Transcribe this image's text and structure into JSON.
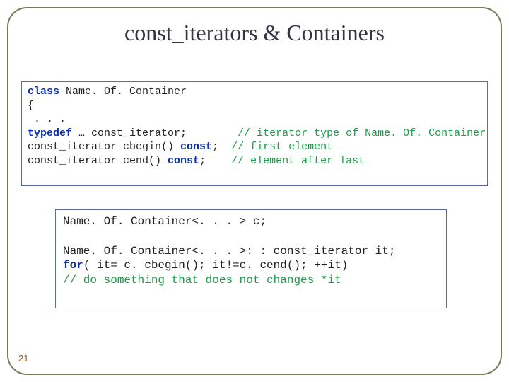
{
  "title": "const_iterators & Containers",
  "pageNumber": "21",
  "code1": {
    "l1a": "class",
    "l1b": " Name. Of. Container",
    "l2": "{",
    "l3": " . . . ",
    "l4a": "typedef",
    "l4b": " … const_iterator;        ",
    "l4c": "// iterator type of Name. Of. Container",
    "l5a": "const_iterator cbegin() ",
    "l5b": "const",
    "l5c": ";  ",
    "l5d": "// first element",
    "l6a": "const_iterator cend() ",
    "l6b": "const",
    "l6c": ";    ",
    "l6d": "// element after last"
  },
  "code2": {
    "l1": "Name. Of. Container<. . . > c;",
    "blank": "",
    "l2": "Name. Of. Container<. . . >: : const_iterator it;",
    "l3a": "for",
    "l3b": "( it= c. cbegin(); it!=c. cend(); ++it)",
    "l4": "// do something that does not changes *it"
  }
}
